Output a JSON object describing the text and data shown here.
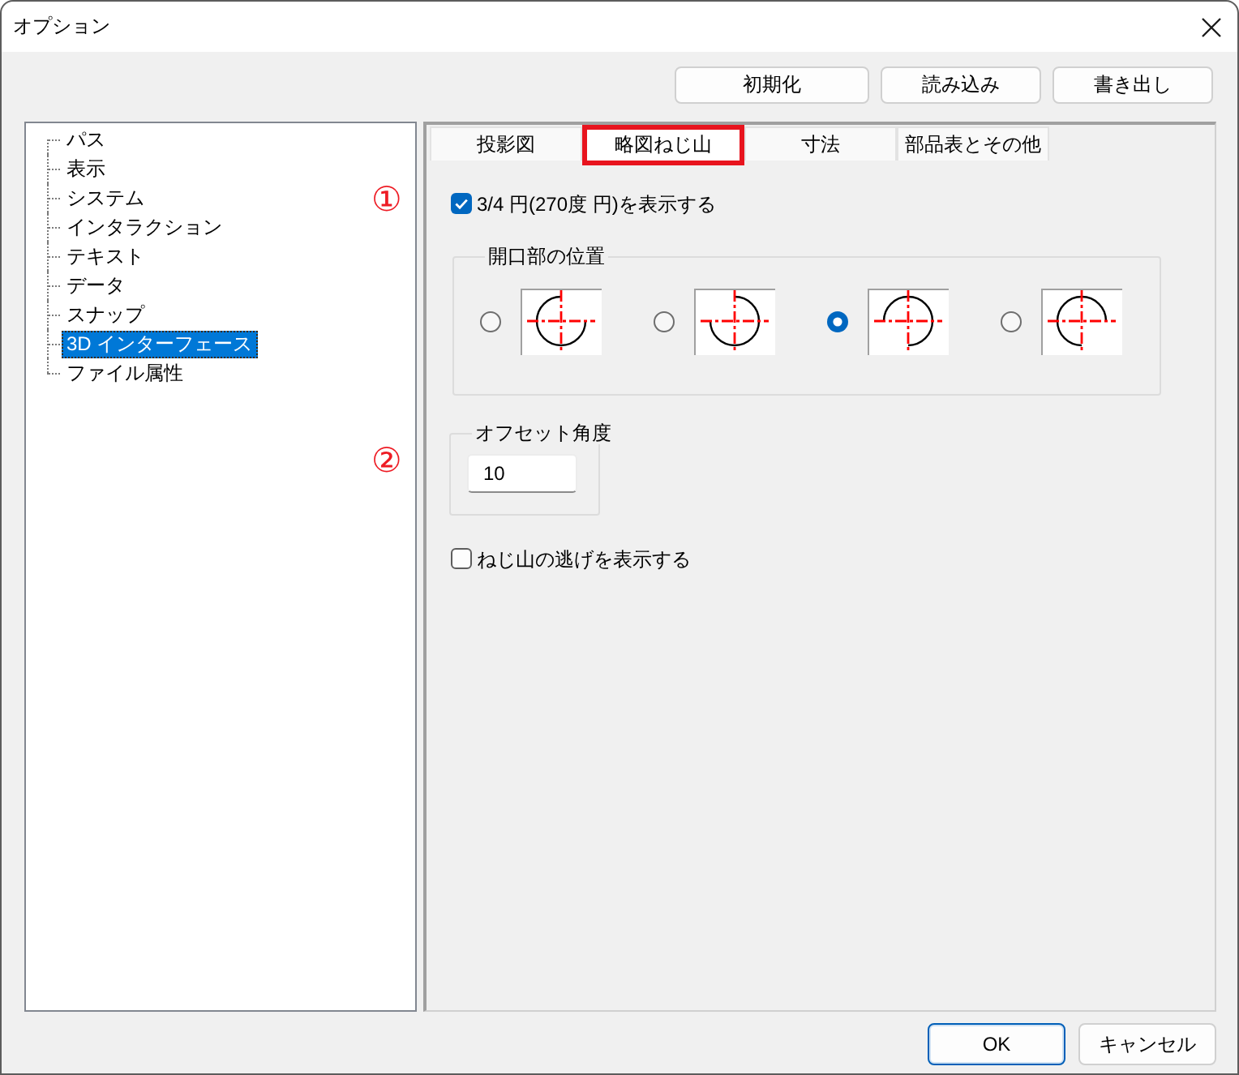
{
  "window": {
    "title": "オプション"
  },
  "toolbar": {
    "buttons": [
      "初期化",
      "読み込み",
      "書き出し"
    ]
  },
  "sidebar": {
    "items": [
      {
        "label": "パス",
        "selected": false
      },
      {
        "label": "表示",
        "selected": false
      },
      {
        "label": "システム",
        "selected": false
      },
      {
        "label": "インタラクション",
        "selected": false
      },
      {
        "label": "テキスト",
        "selected": false
      },
      {
        "label": "データ",
        "selected": false
      },
      {
        "label": "スナップ",
        "selected": false
      },
      {
        "label": "3D インターフェース",
        "selected": true
      },
      {
        "label": "ファイル属性",
        "selected": false
      }
    ]
  },
  "annotations": [
    {
      "text": "①"
    },
    {
      "text": "②"
    }
  ],
  "tabs": [
    {
      "label": "投影図",
      "selected": false,
      "marked": false
    },
    {
      "label": "略図ねじ山",
      "selected": true,
      "marked": true
    },
    {
      "label": "寸法",
      "selected": false,
      "marked": false
    },
    {
      "label": "部品表とその他",
      "selected": false,
      "marked": false
    }
  ],
  "panel": {
    "arc_checkbox": {
      "label": "3/4 円(270度 円)を表示する",
      "checked": true
    },
    "opening_group": {
      "title": "開口部の位置",
      "options": [
        {
          "kind": "northeast",
          "selected": false
        },
        {
          "kind": "northwest",
          "selected": false
        },
        {
          "kind": "southwest",
          "selected": true
        },
        {
          "kind": "southeast",
          "selected": false
        }
      ]
    },
    "offset_group": {
      "title": "オフセット角度",
      "value": "10"
    },
    "relief_checkbox": {
      "label": "ねじ山の逃げを表示する",
      "checked": false
    }
  },
  "buttons": [
    {
      "label": "OK",
      "default": true
    },
    {
      "label": "キャンセル",
      "default": false
    }
  ]
}
